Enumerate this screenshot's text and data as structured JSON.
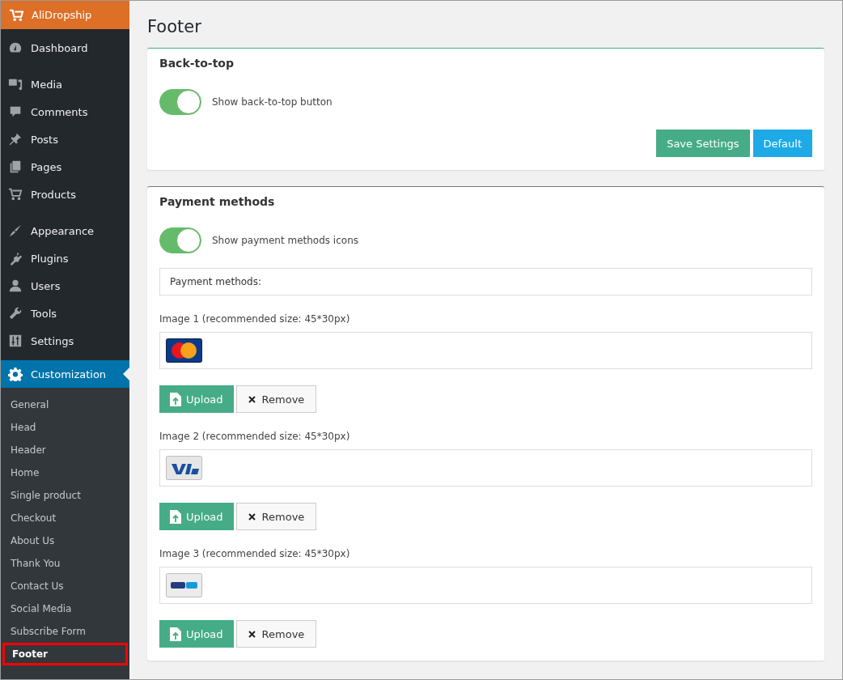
{
  "sidebar": {
    "brand": "AliDropship",
    "groups": [
      [
        {
          "label": "Dashboard",
          "selected": false
        }
      ],
      [
        {
          "label": "Media",
          "selected": false
        },
        {
          "label": "Comments",
          "selected": false
        },
        {
          "label": "Posts",
          "selected": false
        },
        {
          "label": "Pages",
          "selected": false
        },
        {
          "label": "Products",
          "selected": false
        }
      ],
      [
        {
          "label": "Appearance",
          "selected": false
        },
        {
          "label": "Plugins",
          "selected": false
        },
        {
          "label": "Users",
          "selected": false
        },
        {
          "label": "Tools",
          "selected": false
        },
        {
          "label": "Settings",
          "selected": false
        }
      ]
    ],
    "active": {
      "label": "Customization",
      "selected": true,
      "expanded": true,
      "children": [
        {
          "label": "General",
          "selected": false
        },
        {
          "label": "Head",
          "selected": false
        },
        {
          "label": "Header",
          "selected": false
        },
        {
          "label": "Home",
          "selected": false
        },
        {
          "label": "Single product",
          "selected": false
        },
        {
          "label": "Checkout",
          "selected": false
        },
        {
          "label": "About Us",
          "selected": false
        },
        {
          "label": "Thank You",
          "selected": false
        },
        {
          "label": "Contact Us",
          "selected": false
        },
        {
          "label": "Social Media",
          "selected": false
        },
        {
          "label": "Subscribe Form",
          "selected": false
        },
        {
          "label": "Footer",
          "selected": true
        }
      ]
    }
  },
  "page": {
    "title": "Footer",
    "back_to_top": {
      "title": "Back-to-top",
      "toggle": {
        "label": "Show back-to-top button",
        "on": true
      },
      "buttons": [
        "Save Settings",
        "Default"
      ]
    },
    "payment_methods": {
      "title": "Payment methods",
      "toggle": {
        "label": "Show payment methods icons",
        "on": true
      },
      "field": {
        "value": "Payment methods:"
      },
      "images": [
        {
          "label": "Image 1 (recommended size: 45*30px)",
          "kind": "mastercard",
          "upload": "Upload",
          "remove": "Remove"
        },
        {
          "label": "Image 2 (recommended size: 45*30px)",
          "kind": "visa",
          "upload": "Upload",
          "remove": "Remove"
        },
        {
          "label": "Image 3 (recommended size: 45*30px)",
          "kind": "paypal",
          "upload": "Upload",
          "remove": "Remove"
        }
      ]
    }
  }
}
